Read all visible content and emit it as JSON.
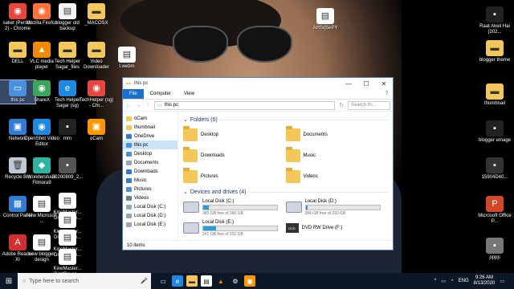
{
  "desktop": {
    "left_icons": [
      {
        "label": "saket (Person 2) - Chrome",
        "color": "#e8453c",
        "glyph": "◉"
      },
      {
        "label": "Mozilla Firefox",
        "color": "#ff7139",
        "glyph": "◉"
      },
      {
        "label": "blogger old backup",
        "color": "#f4f4f4",
        "glyph": "▤"
      },
      {
        "label": "_MACOSX",
        "color": "#f4c75b",
        "glyph": "▬"
      },
      {
        "label": "DELL",
        "color": "#f4c75b",
        "glyph": "▬"
      },
      {
        "label": "VLC media player",
        "color": "#f18a00",
        "glyph": "▲"
      },
      {
        "label": "Tech Helper Sagar_files",
        "color": "#f4c75b",
        "glyph": "▬"
      },
      {
        "label": "Video Downloader",
        "color": "#f4c75b",
        "glyph": "▬"
      },
      {
        "label": "this pc",
        "color": "#4a90e2",
        "glyph": "▭"
      },
      {
        "label": "ShareX",
        "color": "#3ba55c",
        "glyph": "◉"
      },
      {
        "label": "Tech Helper Sagar (sg)",
        "color": "#1e88e5",
        "glyph": "e"
      },
      {
        "label": "TechHelper (sg) - Chr...",
        "color": "#e8453c",
        "glyph": "◉"
      },
      {
        "label": "Network",
        "color": "#2f7bd6",
        "glyph": "▣"
      },
      {
        "label": "OpenShot Video Editor",
        "color": "#1e88e5",
        "glyph": "◉"
      },
      {
        "label": "mm",
        "color": "#222",
        "glyph": "▪"
      },
      {
        "label": "oCam",
        "color": "#ff9800",
        "glyph": "▣"
      },
      {
        "label": "Recycle Bin",
        "color": "#bfc9d4",
        "glyph": "🗑"
      },
      {
        "label": "Wondershare Filmora9",
        "color": "#2bb5a2",
        "glyph": "◆"
      },
      {
        "label": "20200809_2...",
        "color": "#555",
        "glyph": "▪"
      },
      {
        "label": "Control Panel",
        "color": "#2f7bd6",
        "glyph": "▦"
      },
      {
        "label": "New Microsoft ...",
        "color": "#fff",
        "glyph": "▤"
      },
      {
        "label": "KineMaster... DigitBin.co...",
        "color": "#fff",
        "glyph": "▤"
      },
      {
        "label": "KineMaster... DigitBin.co...",
        "color": "#fff",
        "glyph": "▤"
      },
      {
        "label": "Adobe Reader XI",
        "color": "#d32f2f",
        "glyph": "A"
      },
      {
        "label": "new blogger design",
        "color": "#fff",
        "glyph": "▤"
      },
      {
        "label": "KineMaster... DigitBin.co...",
        "color": "#fff",
        "glyph": "▤"
      },
      {
        "label": "KineMaster... DigitBin.co...",
        "color": "#fff",
        "glyph": "▤"
      }
    ],
    "float_icons": [
      {
        "label": "AHSrjSePY",
        "color": "#fff",
        "glyph": "▤"
      },
      {
        "label": "t.webm",
        "color": "#fff",
        "glyph": "▤"
      }
    ],
    "right_icons": [
      {
        "label": "Raat Akeli Hai (202...",
        "color": "#222",
        "glyph": "▪"
      },
      {
        "label": "blogger theme",
        "color": "#f4c75b",
        "glyph": "▬"
      },
      {
        "label": "thumbnail",
        "color": "#f4c75b",
        "glyph": "▬"
      },
      {
        "label": "blogger emage",
        "color": "#222",
        "glyph": "▪"
      },
      {
        "label": "15904D40...",
        "color": "#333",
        "glyph": "▪"
      },
      {
        "label": "Microsoft Office P...",
        "color": "#d24726",
        "glyph": "P"
      },
      {
        "label": "pppp",
        "color": "#777",
        "glyph": "▪"
      }
    ]
  },
  "window": {
    "title": "this pc",
    "ribbon_tabs": [
      "File",
      "Computer",
      "View"
    ],
    "address": "this pc",
    "search_placeholder": "Search th...",
    "nav_items": [
      {
        "label": "oCam",
        "color": "#f4c75b",
        "sel": false
      },
      {
        "label": "thumbnail",
        "color": "#f4c75b",
        "sel": false
      },
      {
        "label": "OneDrive",
        "color": "#2f7bd6",
        "sel": false
      },
      {
        "label": "this pc",
        "color": "#4a90e2",
        "sel": true
      },
      {
        "label": "Desktop",
        "color": "#4a90e2",
        "sel": false
      },
      {
        "label": "Documents",
        "color": "#9aa6b6",
        "sel": false
      },
      {
        "label": "Downloads",
        "color": "#2f7bd6",
        "sel": false
      },
      {
        "label": "Music",
        "color": "#2f7bd6",
        "sel": false
      },
      {
        "label": "Pictures",
        "color": "#4a90e2",
        "sel": false
      },
      {
        "label": "Videos",
        "color": "#6a7e94",
        "sel": false
      },
      {
        "label": "Local Disk (C:)",
        "color": "#9aa6b6",
        "sel": false
      },
      {
        "label": "Local Disk (D:)",
        "color": "#9aa6b6",
        "sel": false
      },
      {
        "label": "Local Disk (E:)",
        "color": "#9aa6b6",
        "sel": false
      }
    ],
    "folders_header": "Folders (6)",
    "folders": [
      "Desktop",
      "Documents",
      "Downloads",
      "Music",
      "Pictures",
      "Videos"
    ],
    "devices_header": "Devices and drives (4)",
    "drives": [
      {
        "name": "Local Disk (C:)",
        "free": "360 GB free of 390 GB",
        "used_fraction": 0.08
      },
      {
        "name": "Local Disk (D:)",
        "free": "284 GB free of 292 GB",
        "used_fraction": 0.03
      },
      {
        "name": "Local Disk (E:)",
        "free": "241 GB free of 292 GB",
        "used_fraction": 0.17
      }
    ],
    "dvd": {
      "name": "DVD RW Drive (F:)",
      "badge": "DVD"
    },
    "status": "10 items"
  },
  "taskbar": {
    "search_placeholder": "Type here to search",
    "lang": "ENG",
    "time": "9:26 AM",
    "date": "8/13/2020"
  }
}
